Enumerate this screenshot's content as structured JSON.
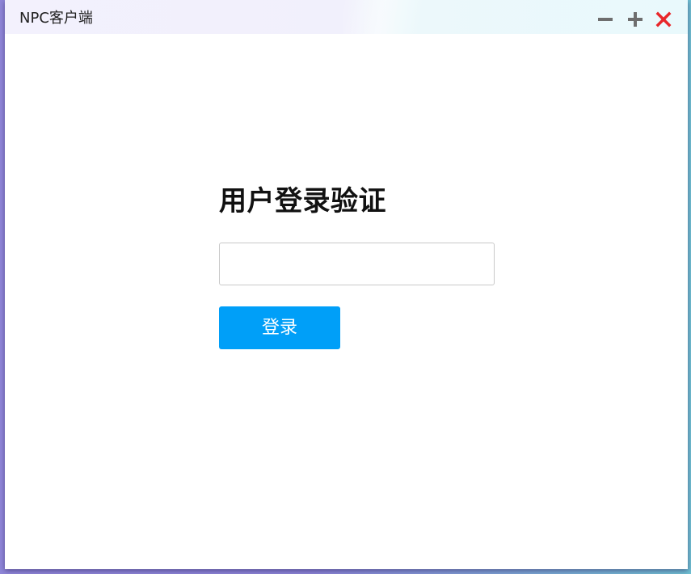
{
  "window": {
    "title": "NPC客户端",
    "controls": {
      "minimize_icon": "minus-icon",
      "maximize_icon": "plus-icon",
      "close_icon": "close-icon"
    }
  },
  "login": {
    "heading": "用户登录验证",
    "input_value": "",
    "button_label": "登录"
  },
  "colors": {
    "accent": "#009ff8",
    "close": "#e8272a",
    "control": "#6e6e6e"
  }
}
